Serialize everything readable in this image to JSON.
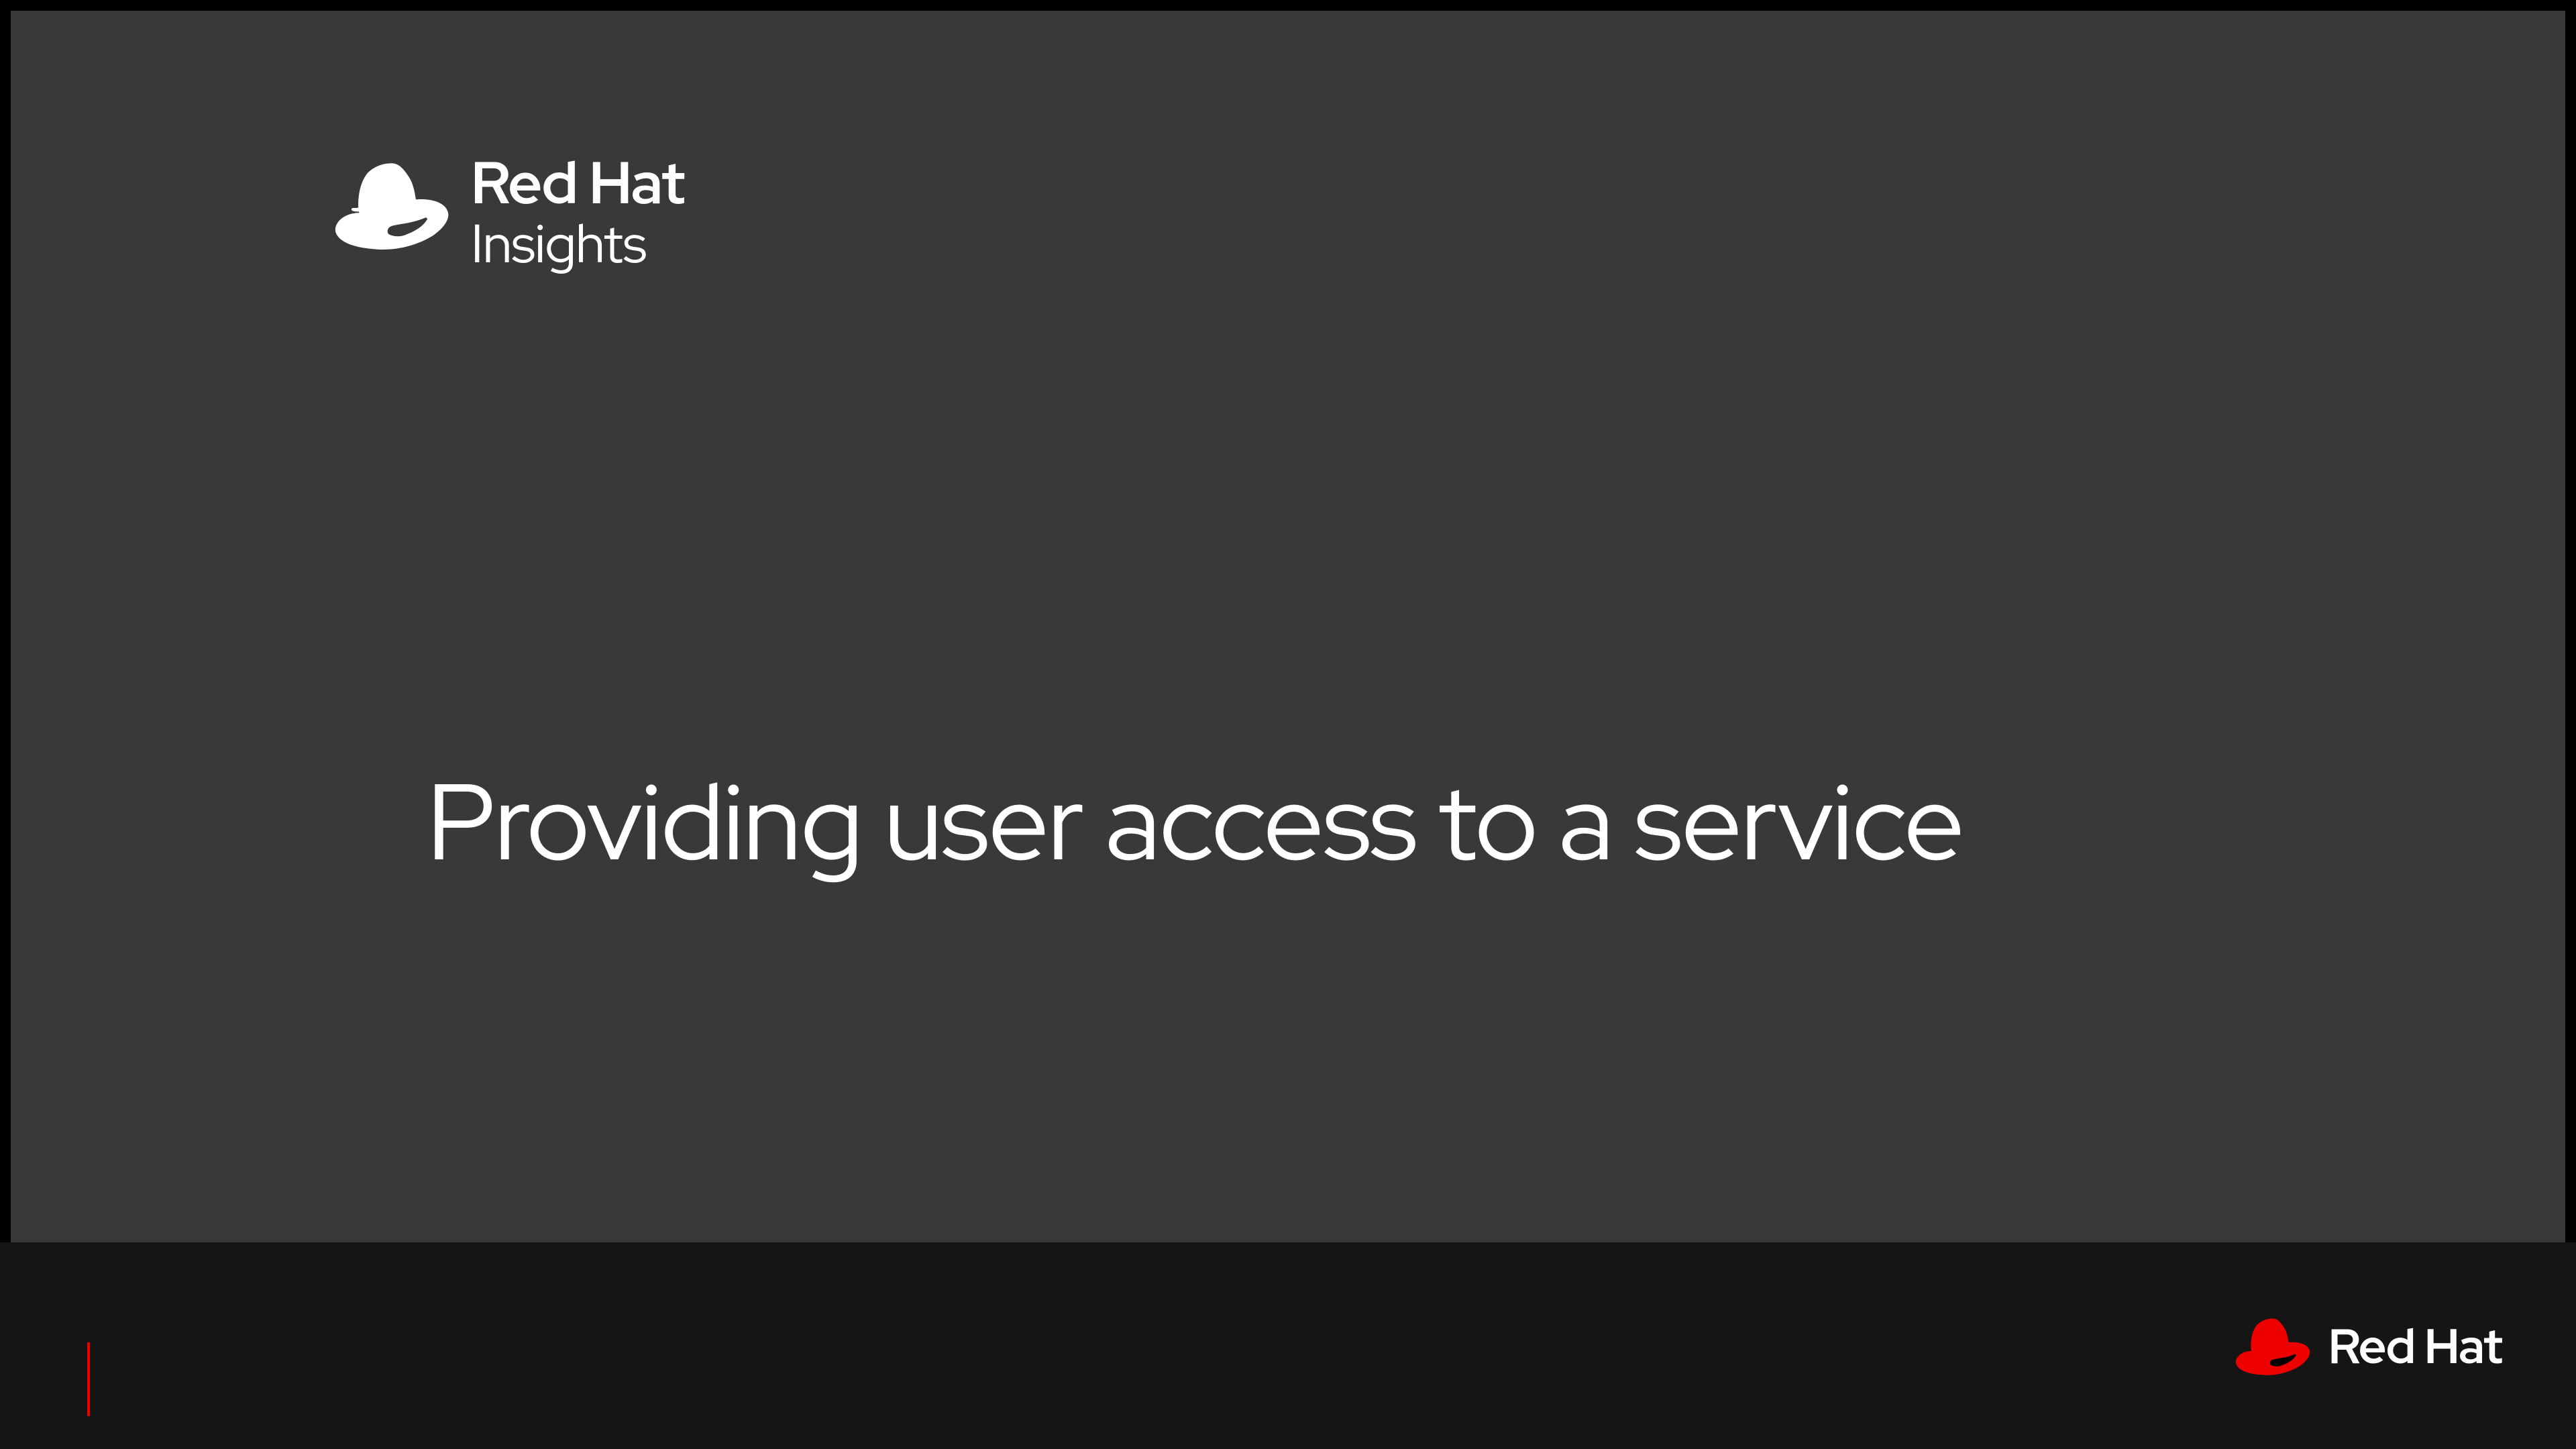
{
  "header": {
    "brand": "Red Hat",
    "product": "Insights"
  },
  "slide": {
    "title": "Providing user access to a service"
  },
  "footer": {
    "brand": "Red Hat"
  },
  "icons": {
    "hat_white": "fedora-hat-icon",
    "hat_red": "fedora-hat-icon"
  },
  "colors": {
    "slide_bg": "#393939",
    "footer_bg": "#151515",
    "accent_red": "#ee0000",
    "text": "#ffffff"
  }
}
